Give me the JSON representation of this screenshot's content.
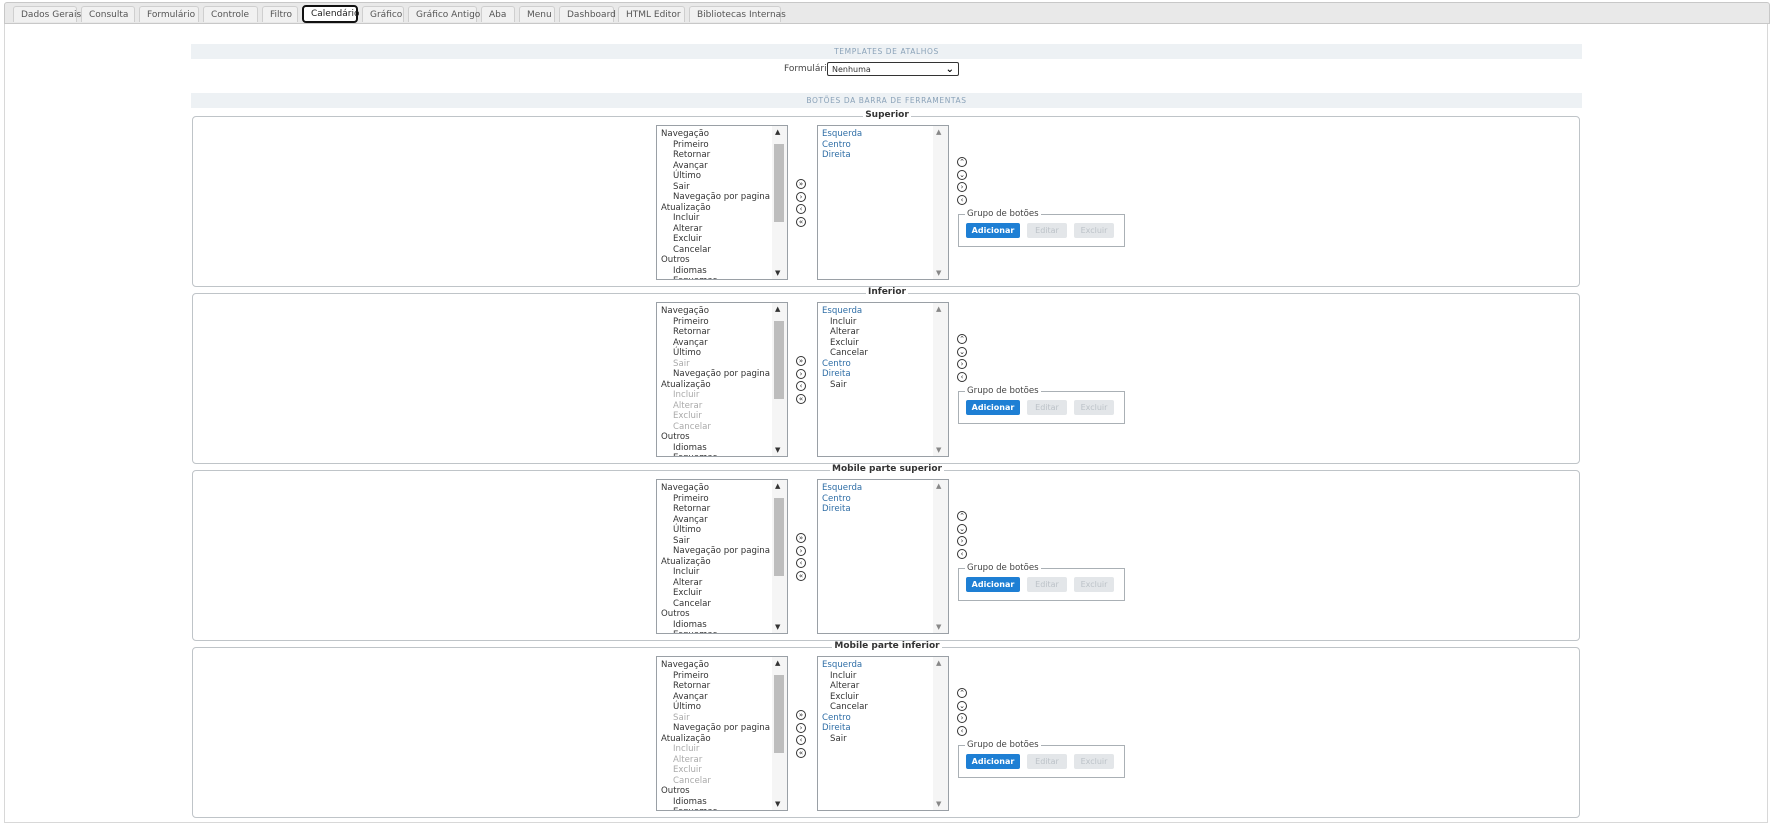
{
  "tabs": [
    {
      "label": "Dados Gerais",
      "active": false
    },
    {
      "label": "Consulta",
      "active": false
    },
    {
      "label": "Formulário",
      "active": false
    },
    {
      "label": "Controle",
      "active": false
    },
    {
      "label": "Filtro",
      "active": false
    },
    {
      "label": "Calendário",
      "active": true
    },
    {
      "label": "Gráfico",
      "active": false
    },
    {
      "label": "Gráfico Antigo",
      "active": false
    },
    {
      "label": "Aba",
      "active": false
    },
    {
      "label": "Menu",
      "active": false
    },
    {
      "label": "Dashboard",
      "active": false
    },
    {
      "label": "HTML Editor",
      "active": false
    },
    {
      "label": "Bibliotecas Internas",
      "active": false
    }
  ],
  "templates": {
    "title": "TEMPLATES DE ATALHOS",
    "form_label": "Formulário",
    "form_value": "Nenhuma"
  },
  "toolbar": {
    "title": "BOTÕES DA BARRA DE FERRAMENTAS",
    "group_legend": "Grupo de botões",
    "add_label": "Adicionar",
    "edit_label": "Editar",
    "delete_label": "Excluir",
    "panels": [
      {
        "title": "Superior",
        "available": [
          {
            "text": "Navegação",
            "kind": "g"
          },
          {
            "text": "Primeiro",
            "kind": "i"
          },
          {
            "text": "Retornar",
            "kind": "i"
          },
          {
            "text": "Avançar",
            "kind": "i"
          },
          {
            "text": "Último",
            "kind": "i"
          },
          {
            "text": "Sair",
            "kind": "i"
          },
          {
            "text": "Navegação por pagina",
            "kind": "i"
          },
          {
            "text": "Atualização",
            "kind": "g"
          },
          {
            "text": "Incluir",
            "kind": "i"
          },
          {
            "text": "Alterar",
            "kind": "i"
          },
          {
            "text": "Excluir",
            "kind": "i"
          },
          {
            "text": "Cancelar",
            "kind": "i"
          },
          {
            "text": "Outros",
            "kind": "g"
          },
          {
            "text": "Idiomas",
            "kind": "i"
          },
          {
            "text": "Esquemas",
            "kind": "i"
          }
        ],
        "selected": [
          {
            "text": "Esquerda",
            "kind": "blue"
          },
          {
            "text": "Centro",
            "kind": "blue"
          },
          {
            "text": "Direita",
            "kind": "blue"
          }
        ]
      },
      {
        "title": "Inferior",
        "available": [
          {
            "text": "Navegação",
            "kind": "g"
          },
          {
            "text": "Primeiro",
            "kind": "i"
          },
          {
            "text": "Retornar",
            "kind": "i"
          },
          {
            "text": "Avançar",
            "kind": "i"
          },
          {
            "text": "Último",
            "kind": "i"
          },
          {
            "text": "Sair",
            "kind": "dis"
          },
          {
            "text": "Navegação por pagina",
            "kind": "i"
          },
          {
            "text": "Atualização",
            "kind": "g"
          },
          {
            "text": "Incluir",
            "kind": "dis"
          },
          {
            "text": "Alterar",
            "kind": "dis"
          },
          {
            "text": "Excluir",
            "kind": "dis"
          },
          {
            "text": "Cancelar",
            "kind": "dis"
          },
          {
            "text": "Outros",
            "kind": "g"
          },
          {
            "text": "Idiomas",
            "kind": "i"
          },
          {
            "text": "Esquemas",
            "kind": "i"
          }
        ],
        "selected": [
          {
            "text": "Esquerda",
            "kind": "blue"
          },
          {
            "text": "Incluir",
            "kind": "ri"
          },
          {
            "text": "Alterar",
            "kind": "ri"
          },
          {
            "text": "Excluir",
            "kind": "ri"
          },
          {
            "text": "Cancelar",
            "kind": "ri"
          },
          {
            "text": "Centro",
            "kind": "blue"
          },
          {
            "text": "Direita",
            "kind": "blue"
          },
          {
            "text": "Sair",
            "kind": "ri"
          }
        ]
      },
      {
        "title": "Mobile parte superior",
        "available": [
          {
            "text": "Navegação",
            "kind": "g"
          },
          {
            "text": "Primeiro",
            "kind": "i"
          },
          {
            "text": "Retornar",
            "kind": "i"
          },
          {
            "text": "Avançar",
            "kind": "i"
          },
          {
            "text": "Último",
            "kind": "i"
          },
          {
            "text": "Sair",
            "kind": "i"
          },
          {
            "text": "Navegação por pagina",
            "kind": "i"
          },
          {
            "text": "Atualização",
            "kind": "g"
          },
          {
            "text": "Incluir",
            "kind": "i"
          },
          {
            "text": "Alterar",
            "kind": "i"
          },
          {
            "text": "Excluir",
            "kind": "i"
          },
          {
            "text": "Cancelar",
            "kind": "i"
          },
          {
            "text": "Outros",
            "kind": "g"
          },
          {
            "text": "Idiomas",
            "kind": "i"
          },
          {
            "text": "Esquemas",
            "kind": "i"
          }
        ],
        "selected": [
          {
            "text": "Esquerda",
            "kind": "blue"
          },
          {
            "text": "Centro",
            "kind": "blue"
          },
          {
            "text": "Direita",
            "kind": "blue"
          }
        ]
      },
      {
        "title": "Mobile parte inferior",
        "available": [
          {
            "text": "Navegação",
            "kind": "g"
          },
          {
            "text": "Primeiro",
            "kind": "i"
          },
          {
            "text": "Retornar",
            "kind": "i"
          },
          {
            "text": "Avançar",
            "kind": "i"
          },
          {
            "text": "Último",
            "kind": "i"
          },
          {
            "text": "Sair",
            "kind": "dis"
          },
          {
            "text": "Navegação por pagina",
            "kind": "i"
          },
          {
            "text": "Atualização",
            "kind": "g"
          },
          {
            "text": "Incluir",
            "kind": "dis"
          },
          {
            "text": "Alterar",
            "kind": "dis"
          },
          {
            "text": "Excluir",
            "kind": "dis"
          },
          {
            "text": "Cancelar",
            "kind": "dis"
          },
          {
            "text": "Outros",
            "kind": "g"
          },
          {
            "text": "Idiomas",
            "kind": "i"
          },
          {
            "text": "Esquemas",
            "kind": "i"
          }
        ],
        "selected": [
          {
            "text": "Esquerda",
            "kind": "blue"
          },
          {
            "text": "Incluir",
            "kind": "ri"
          },
          {
            "text": "Alterar",
            "kind": "ri"
          },
          {
            "text": "Excluir",
            "kind": "ri"
          },
          {
            "text": "Cancelar",
            "kind": "ri"
          },
          {
            "text": "Centro",
            "kind": "blue"
          },
          {
            "text": "Direita",
            "kind": "blue"
          },
          {
            "text": "Sair",
            "kind": "ri"
          }
        ]
      }
    ]
  },
  "icons": {
    "move_all_right": "»",
    "move_right": "›",
    "move_left": "‹",
    "move_all_left": "«",
    "move_top": "⌃",
    "move_up": "⌄",
    "move_down": "›",
    "move_bottom": "‹",
    "dropdown": "chevron-down-icon"
  }
}
